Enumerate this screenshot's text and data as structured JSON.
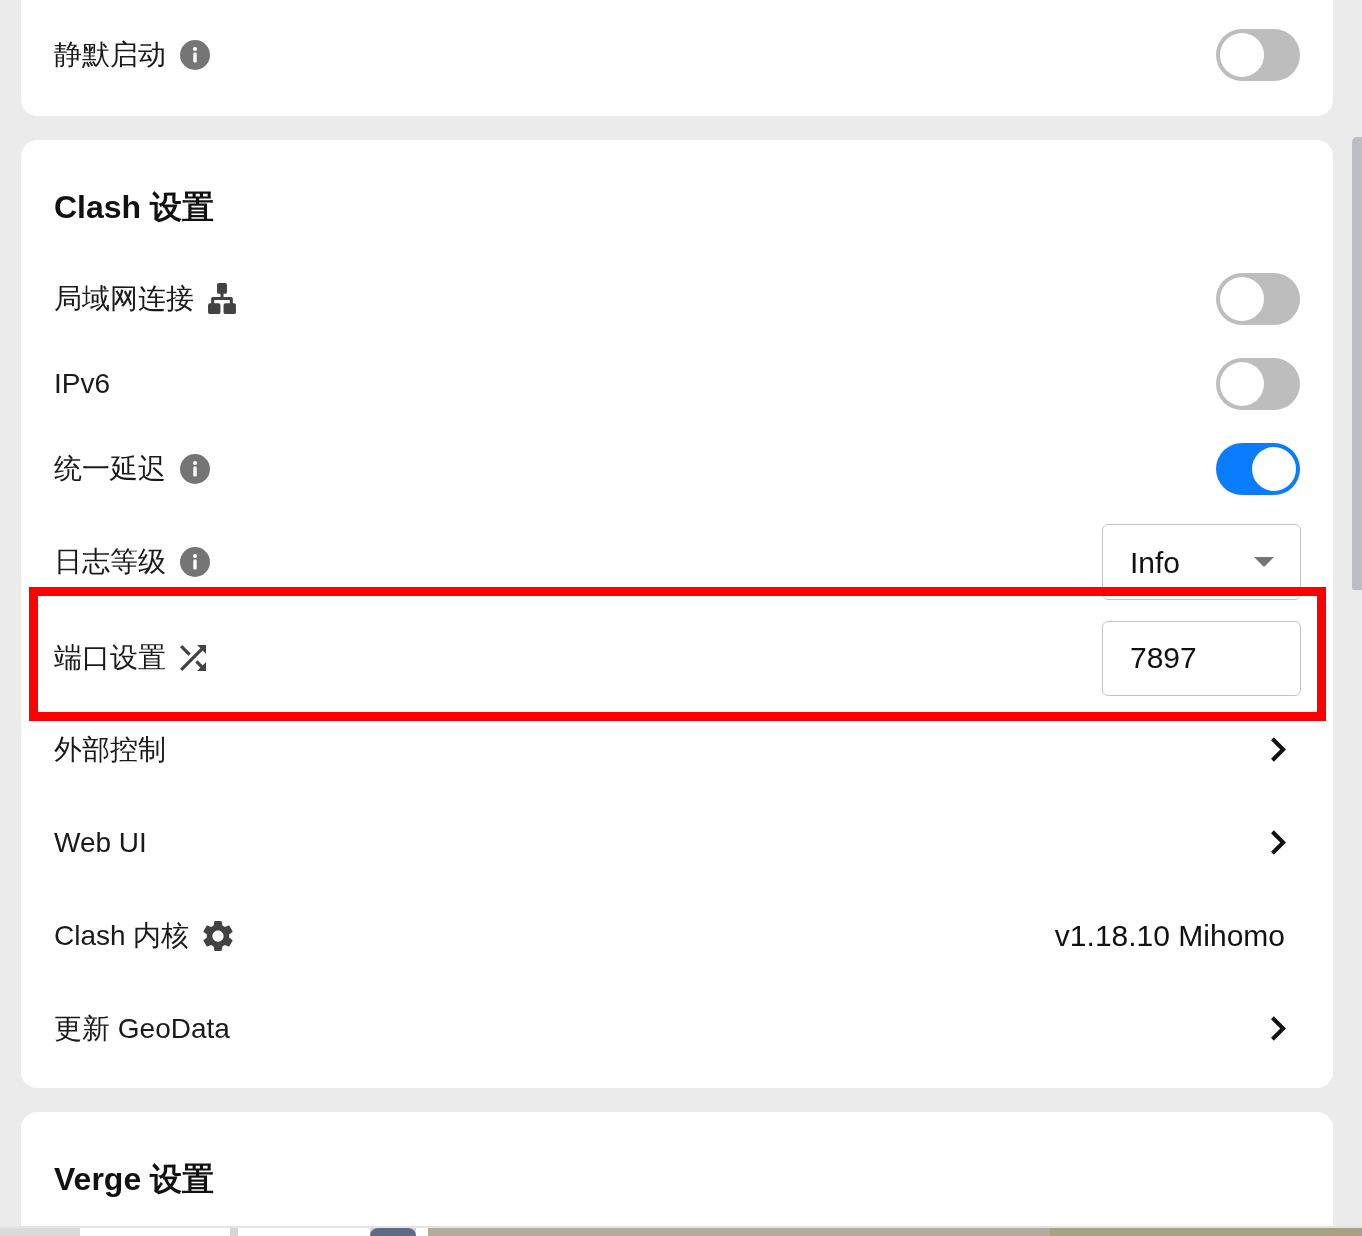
{
  "cards": [
    {
      "rows": [
        {
          "kind": "toggle",
          "label": "静默启动",
          "on": false,
          "highlighted": false
        }
      ]
    },
    {
      "title": "Clash 设置",
      "rows": [
        {
          "kind": "toggle",
          "label": "局域网连接",
          "on": false,
          "highlighted": false
        },
        {
          "kind": "toggle",
          "label": "IPv6",
          "on": false,
          "highlighted": false
        },
        {
          "kind": "toggle",
          "label": "统一延迟",
          "on": true,
          "highlighted": false
        },
        {
          "kind": "select",
          "label": "日志等级",
          "value": "Info",
          "highlighted": false
        },
        {
          "kind": "input",
          "label": "端口设置",
          "value": "7897",
          "highlighted": true
        },
        {
          "kind": "link",
          "label": "外部控制",
          "highlighted": false
        },
        {
          "kind": "link",
          "label": "Web UI",
          "highlighted": false
        },
        {
          "kind": "value",
          "label": "Clash 内核",
          "value": "v1.18.10 Mihomo",
          "highlighted": false
        },
        {
          "kind": "link",
          "label": "更新 GeoData",
          "highlighted": false
        }
      ]
    },
    {
      "title": "Verge 设置"
    }
  ]
}
